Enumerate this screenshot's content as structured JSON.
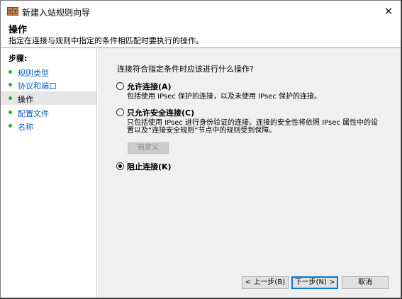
{
  "window": {
    "title": "新建入站规则向导",
    "close_symbol": "✕"
  },
  "header": {
    "title": "操作",
    "description": "指定在连接与规则中指定的条件相匹配时要执行的操作。"
  },
  "sidebar": {
    "steps_label": "步骤:",
    "items": [
      {
        "label": "规则类型"
      },
      {
        "label": "协议和端口"
      },
      {
        "label": "操作"
      },
      {
        "label": "配置文件"
      },
      {
        "label": "名称"
      }
    ]
  },
  "content": {
    "question": "连接符合指定条件时应该进行什么操作?",
    "options": [
      {
        "label": "允许连接(A)",
        "description": [
          "包括使用 IPsec 保护的连接，以及未使用 IPsec 保护的连接。"
        ],
        "checked": false
      },
      {
        "label": "只允许安全连接(C)",
        "description": [
          "只包括使用 IPsec 进行身份验证的连接。连接的安全性将依照 IPsec 属性中的设",
          "置以及“连接安全规则”节点中的规则受到保障。"
        ],
        "checked": false
      },
      {
        "label": "阻止连接(K)",
        "description": [],
        "checked": true
      }
    ],
    "custom_button": "自定义"
  },
  "buttons": {
    "back": "< 上一步(B)",
    "next": "下一步(N) >",
    "cancel": "取消"
  },
  "icons": {
    "app": "firewall-icon",
    "close": "close-icon",
    "step": "step-bullet-icon"
  },
  "colors": {
    "step_link": "#0a5fbf",
    "step_dot": "#36a53a",
    "accent": "#0078d7",
    "content_bg": "#f0f0f0"
  }
}
